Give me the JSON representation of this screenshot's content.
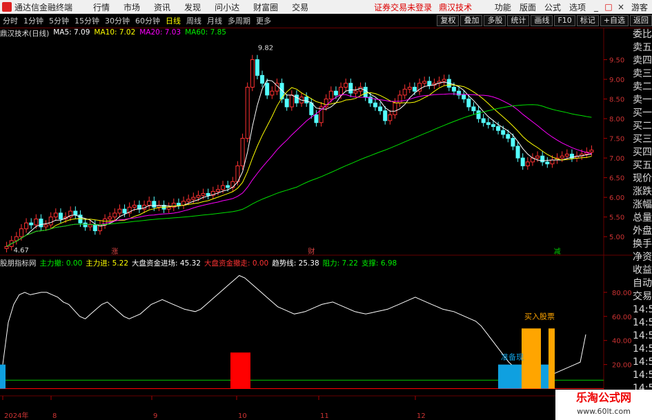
{
  "menubar": {
    "app_name": "通达信金融终端",
    "items": [
      "行情",
      "市场",
      "资讯",
      "发现",
      "问小达",
      "财富圈",
      "交易"
    ],
    "notice": "证券交易未登录",
    "indicator_name": "鼎汉技术",
    "right_items": [
      "功能",
      "版面",
      "公式",
      "选项"
    ],
    "guest": "游客"
  },
  "toolbar": {
    "periods": [
      "分时",
      "1分钟",
      "5分钟",
      "15分钟",
      "30分钟",
      "60分钟",
      "日线",
      "周线",
      "月线",
      "多周期",
      "更多"
    ],
    "active_period": "日线",
    "right_buttons": [
      "复权",
      "叠加",
      "多股",
      "统计",
      "画线",
      "F10",
      "标记",
      "+自选",
      "返回"
    ]
  },
  "main_legend": {
    "stock": "鼎汉技术(日线)",
    "ma5": "MA5: 7.09",
    "ma10": "MA10: 7.02",
    "ma20": "MA20: 7.03",
    "ma60": "MA60: 7.85"
  },
  "sub_legend": {
    "name": "股朋指标网",
    "main_out": "主力撤: 0.00",
    "main_in": "主力进: 5.22",
    "big_in": "大盘资金进场: 45.32",
    "big_out": "大盘资金撤走: 0.00",
    "trend": "趋势线: 25.38",
    "resist": "阻力: 7.22",
    "support": "支撑: 6.98"
  },
  "colors": {
    "candle_up": "#ff3232",
    "candle_down": "#54ffff",
    "ma5": "#ffffff",
    "ma10": "#ffff00",
    "ma20": "#ff00ff",
    "ma60": "#00e000",
    "trend_line": "#ffffff",
    "support": "#00cc00",
    "resist": "#ff0000",
    "bar_red": "#ff0000",
    "bar_orange": "#ffa500",
    "bar_blue": "#0fa0e0"
  },
  "chart_data": [
    {
      "type": "candlestick",
      "price_axis_ticks": [
        9.5,
        9.0,
        8.5,
        8.0,
        7.5,
        7.0,
        6.5,
        6.0,
        5.5,
        5.0
      ],
      "ylim": [
        4.6,
        10.0
      ],
      "high_label": "9.82",
      "low_label": "4.67",
      "event_markers": [
        {
          "text": "涨",
          "index": 22
        },
        {
          "text": "财",
          "index": 62
        },
        {
          "text": "减",
          "index": 112
        }
      ],
      "closes": [
        4.75,
        4.9,
        5.0,
        5.2,
        5.35,
        5.3,
        5.45,
        5.25,
        5.3,
        5.5,
        5.6,
        5.45,
        5.5,
        5.65,
        5.55,
        5.35,
        5.25,
        5.3,
        5.15,
        5.3,
        5.45,
        5.5,
        5.6,
        5.7,
        5.6,
        5.75,
        5.8,
        5.7,
        5.8,
        5.9,
        5.75,
        5.8,
        5.7,
        5.75,
        5.85,
        5.8,
        5.9,
        5.95,
        6.0,
        6.05,
        6.1,
        6.05,
        6.15,
        6.2,
        6.3,
        6.25,
        6.4,
        6.8,
        7.5,
        8.8,
        9.5,
        9.1,
        8.9,
        8.6,
        8.7,
        8.9,
        8.5,
        8.3,
        8.6,
        8.4,
        8.55,
        8.4,
        8.1,
        7.9,
        8.3,
        8.5,
        8.7,
        8.6,
        8.8,
        8.9,
        8.65,
        8.7,
        8.8,
        8.55,
        8.4,
        8.3,
        8.2,
        7.95,
        8.1,
        8.4,
        8.6,
        8.75,
        8.8,
        8.7,
        8.9,
        8.95,
        8.85,
        8.9,
        8.95,
        9.0,
        8.8,
        8.7,
        8.6,
        8.5,
        8.3,
        8.2,
        8.0,
        7.9,
        7.85,
        7.8,
        7.7,
        7.6,
        7.5,
        7.3,
        7.0,
        6.8,
        6.9,
        7.0,
        7.05,
        6.9,
        6.85,
        6.95,
        7.0,
        7.05,
        7.1,
        7.0,
        7.05,
        7.1,
        7.15,
        7.2
      ],
      "series": [
        {
          "name": "MA5",
          "values": []
        },
        {
          "name": "MA10",
          "values": []
        },
        {
          "name": "MA20",
          "values": []
        },
        {
          "name": "MA60",
          "values": []
        }
      ]
    },
    {
      "type": "bar",
      "yticks": [
        "80.00",
        "60.00",
        "40.00",
        "20.00"
      ],
      "ylim": [
        -2,
        100
      ],
      "annotations": [
        {
          "text": "买入股票",
          "index": 112
        },
        {
          "text": "准备现",
          "index": 103
        }
      ],
      "trend_values": [
        20,
        55,
        70,
        78,
        80,
        78,
        79,
        80,
        80,
        78,
        76,
        72,
        70,
        65,
        60,
        58,
        62,
        66,
        70,
        72,
        68,
        64,
        60,
        58,
        60,
        62,
        66,
        70,
        72,
        74,
        72,
        70,
        68,
        66,
        65,
        64,
        66,
        70,
        74,
        78,
        82,
        86,
        90,
        94,
        92,
        88,
        84,
        80,
        76,
        72,
        68,
        66,
        64,
        62,
        63,
        64,
        66,
        68,
        70,
        71,
        72,
        70,
        68,
        66,
        64,
        63,
        62,
        63,
        64,
        65,
        66,
        68,
        70,
        72,
        74,
        76,
        74,
        72,
        70,
        68,
        66,
        65,
        64,
        62,
        60,
        58,
        56,
        52,
        46,
        40,
        34,
        28,
        22,
        18,
        14,
        12,
        10,
        9,
        8,
        10,
        12,
        14,
        16,
        18,
        20,
        22,
        45
      ]
    }
  ]
}
